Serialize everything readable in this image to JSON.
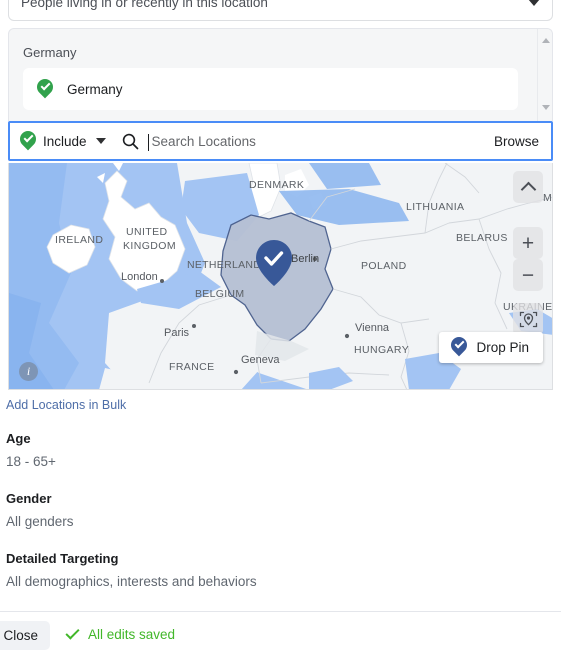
{
  "location_type": {
    "label": "People living in or recently in this location",
    "caret_icon": "chevron-down-icon"
  },
  "selected_locations": {
    "group_title": "Germany",
    "items": [
      {
        "label": "Germany",
        "pin_icon": "map-pin-check-icon",
        "pin_color": "#31a24c"
      }
    ],
    "scrollbar": {
      "up_icon": "scroll-up-arrow-icon",
      "down_icon": "scroll-down-arrow-icon"
    }
  },
  "search_row": {
    "include_label": "Include",
    "include_pin_icon": "map-pin-check-icon",
    "include_caret_icon": "chevron-down-icon",
    "search_icon": "search-icon",
    "search_value": "",
    "search_placeholder": "Search Locations",
    "browse_label": "Browse",
    "focus_border_color": "#4a8cf7"
  },
  "map": {
    "water_color": "#a3c4f3",
    "land_color": "#f2f4f6",
    "selected_country_fill": "#b6c0d4",
    "selected_country_border": "#4a5f8c",
    "pin_color": "#385898",
    "labels": [
      {
        "text": "IRELAND",
        "type": "country"
      },
      {
        "text": "UNITED",
        "type": "country"
      },
      {
        "text": "KINGDOM",
        "type": "country"
      },
      {
        "text": "London",
        "type": "city"
      },
      {
        "text": "NETHERLANDS",
        "type": "country"
      },
      {
        "text": "BELGIUM",
        "type": "country"
      },
      {
        "text": "FRANCE",
        "type": "country"
      },
      {
        "text": "Paris",
        "type": "city"
      },
      {
        "text": "Geneva",
        "type": "city"
      },
      {
        "text": "DENMARK",
        "type": "country"
      },
      {
        "text": "Berlin",
        "type": "city"
      },
      {
        "text": "POLAND",
        "type": "country"
      },
      {
        "text": "LITHUANIA",
        "type": "country"
      },
      {
        "text": "BELARUS",
        "type": "country"
      },
      {
        "text": "UKRAINE",
        "type": "country"
      },
      {
        "text": "HUNGARY",
        "type": "country"
      },
      {
        "text": "Vienna",
        "type": "city"
      },
      {
        "text": "M",
        "type": "country"
      }
    ],
    "controls": {
      "compass_icon": "compass-up-icon",
      "zoom_in_label": "+",
      "zoom_out_label": "−",
      "locate_icon": "locate-pin-icon",
      "info_label": "i",
      "info_icon": "info-icon"
    },
    "drop_pin": {
      "label": "Drop Pin",
      "pin_icon": "map-pin-check-icon",
      "pin_color": "#385898"
    }
  },
  "bulk_link": {
    "label": "Add Locations in Bulk",
    "color": "#4e6ea8"
  },
  "targeting": {
    "age": {
      "title": "Age",
      "value": "18 - 65+"
    },
    "gender": {
      "title": "Gender",
      "value": "All genders"
    },
    "detailed": {
      "title": "Detailed Targeting",
      "value": "All demographics, interests and behaviors"
    }
  },
  "footer": {
    "close_label": "Close",
    "saved_label": "All edits saved",
    "saved_color": "#42b72a",
    "check_icon": "checkmark-icon"
  }
}
